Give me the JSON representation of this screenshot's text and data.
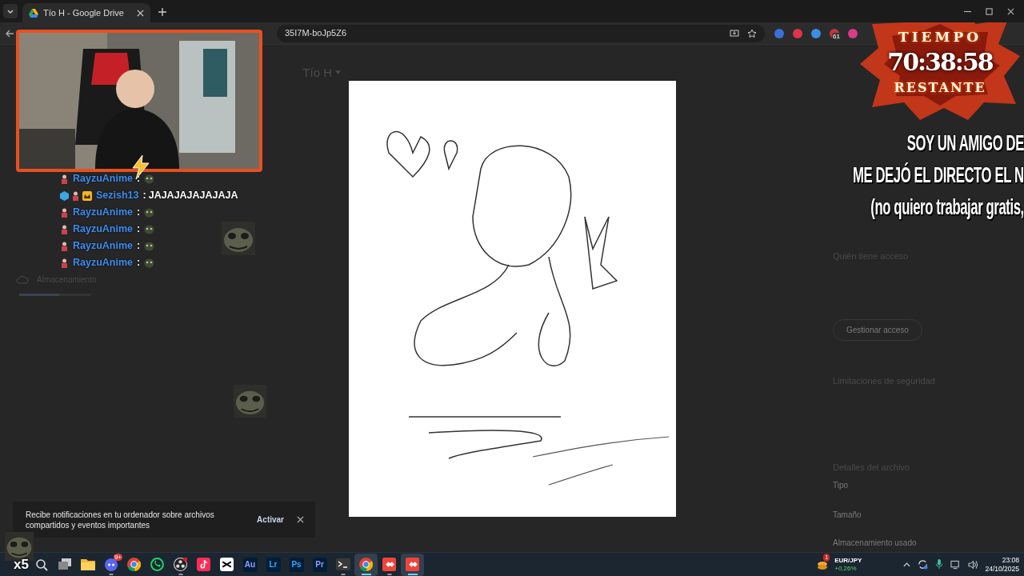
{
  "browser": {
    "tab": {
      "title": "Tío H - Google Drive",
      "selected": true
    },
    "address": "35I7M-boJp5Z6",
    "extensions": [
      {
        "color": "#3b6fd8"
      },
      {
        "color": "#e0334a"
      },
      {
        "color": "#3a8ee6"
      },
      {
        "color": "#c2323a",
        "badge": "61"
      },
      {
        "color": "#d83b8a"
      }
    ]
  },
  "drive": {
    "title": "Tío H",
    "sidebar": [
      {
        "label": "Almacenamiento",
        "level": 0.55
      }
    ],
    "details": [
      {
        "kind": "heading",
        "text": "Quién tiene acceso"
      },
      {
        "kind": "button",
        "text": "Gestionar acceso"
      },
      {
        "kind": "heading",
        "text": "Limitaciones de seguridad"
      },
      {
        "kind": "heading",
        "text": "Detalles del archivo"
      },
      {
        "kind": "label",
        "text": "Tipo"
      },
      {
        "kind": "label",
        "text": "Tamaño"
      },
      {
        "kind": "label",
        "text": "Almacenamiento usado"
      }
    ]
  },
  "preview": {
    "kind": "picture"
  },
  "webcam": {
    "kind": "picture"
  },
  "chat": [
    {
      "user": "RayzuAnime",
      "separator": ":",
      "kind": "emote",
      "badges": [
        {
          "kind": "figure"
        }
      ]
    },
    {
      "user": "Sezish13",
      "separator": ":",
      "kind": "text",
      "message": "JAJAJAJAJAJAJA",
      "badges": [
        {
          "kind": "cube"
        },
        {
          "kind": "figure"
        },
        {
          "kind": "crown"
        }
      ]
    },
    {
      "user": "RayzuAnime",
      "separator": ":",
      "kind": "emote",
      "badges": [
        {
          "kind": "figure"
        }
      ]
    },
    {
      "user": "RayzuAnime",
      "separator": ":",
      "kind": "emote",
      "badges": [
        {
          "kind": "figure"
        }
      ]
    },
    {
      "user": "RayzuAnime",
      "separator": ":",
      "kind": "emote",
      "badges": [
        {
          "kind": "figure"
        }
      ]
    },
    {
      "user": "RayzuAnime",
      "separator": ":",
      "kind": "emote",
      "badges": [
        {
          "kind": "figure"
        }
      ]
    }
  ],
  "timer": {
    "top": "TIEMPO",
    "time": "70:38:58",
    "bottom": "RESTANTE"
  },
  "stream_text": [
    "SOY UN AMIGO DE",
    "ME DEJÓ EL DIRECTO EL N",
    "(no quiero trabajar gratis,"
  ],
  "emote_combo": {
    "count": "x5"
  },
  "toast": {
    "message": "Recibe notificaciones en tu ordenador sobre archivos compartidos y eventos importantes",
    "action": "Activar"
  },
  "taskbar": {
    "apps": [
      {
        "kind": "search",
        "running": false,
        "selected": false
      },
      {
        "kind": "taskview",
        "running": false,
        "selected": false
      },
      {
        "kind": "folder",
        "running": false,
        "selected": false
      },
      {
        "kind": "discord",
        "badge": "9+",
        "running": true,
        "selected": false
      },
      {
        "kind": "chrome",
        "running": false,
        "selected": false
      },
      {
        "kind": "whatsapp",
        "running": false,
        "selected": false
      },
      {
        "kind": "obs",
        "running": true,
        "selected": false
      },
      {
        "kind": "tiktok",
        "running": false,
        "selected": false
      },
      {
        "kind": "capcut",
        "running": false,
        "selected": false
      },
      {
        "kind": "adobe",
        "label": "Au",
        "color": "#9999ff",
        "running": false,
        "selected": false
      },
      {
        "kind": "adobe",
        "label": "Lr",
        "color": "#31a8ff",
        "running": false,
        "selected": false
      },
      {
        "kind": "adobe",
        "label": "Ps",
        "color": "#31a8ff",
        "running": false,
        "selected": false
      },
      {
        "kind": "adobe",
        "label": "Pr",
        "color": "#9999ff",
        "running": false,
        "selected": false
      },
      {
        "kind": "terminal",
        "running": true,
        "selected": false
      },
      {
        "kind": "chrome",
        "running": true,
        "selected": true
      },
      {
        "kind": "anydesk",
        "running": true,
        "selected": false
      },
      {
        "kind": "anydesk",
        "running": true,
        "selected": true
      }
    ],
    "widget": {
      "badge": "1",
      "title": "EUR/JPY",
      "change": "+0,26%"
    },
    "time": "23:08",
    "date": "24/10/2025"
  }
}
